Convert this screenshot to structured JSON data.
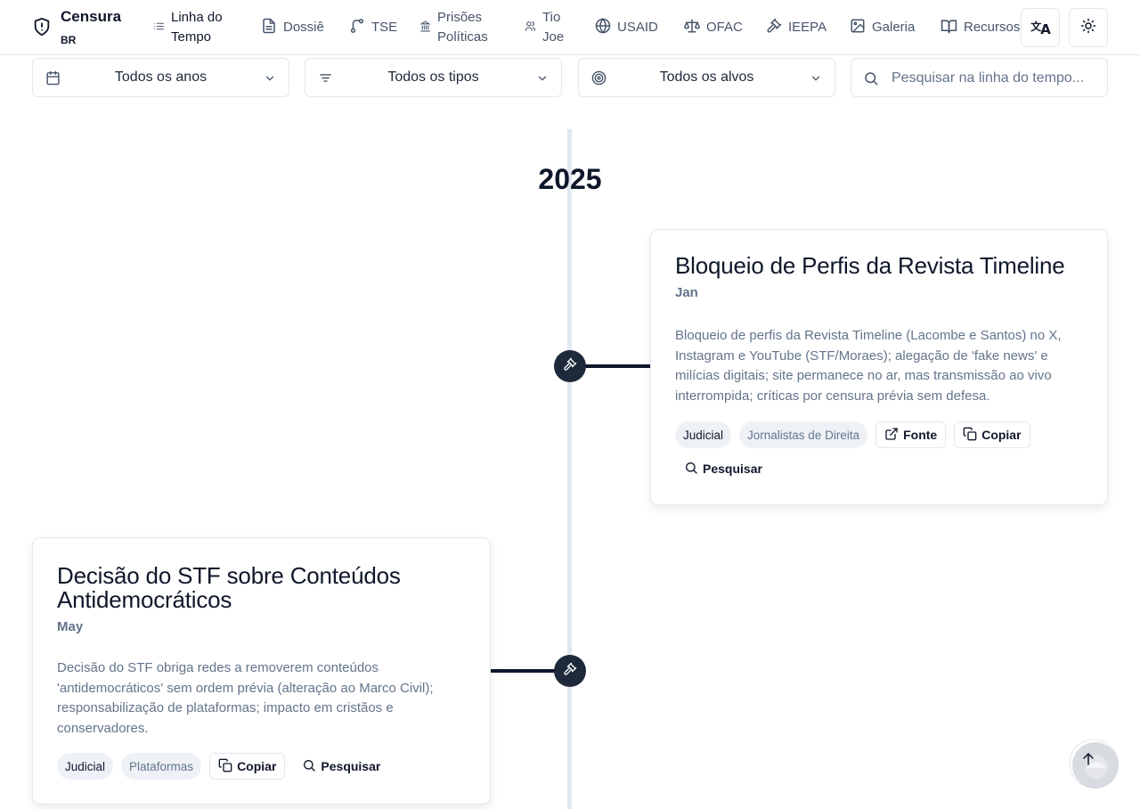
{
  "brand": {
    "title": "Censura",
    "subtitle": "BR"
  },
  "nav": {
    "timeline": "Linha do Tempo",
    "dossie": "Dossiê",
    "tse": "TSE",
    "prisoes": "Prisões Políticas",
    "tio_joe": "Tio Joe",
    "usaid": "USAID",
    "ofac": "OFAC",
    "ieepa": "IEEPA",
    "galeria": "Galeria",
    "recursos": "Recursos"
  },
  "filters": {
    "year": "Todos os anos",
    "type": "Todos os tipos",
    "target": "Todos os alvos",
    "search_placeholder": "Pesquisar na linha do tempo..."
  },
  "timeline": {
    "year": "2025",
    "events": [
      {
        "title": "Bloqueio de Perfis da Revista Timeline",
        "date": "Jan",
        "description": "Bloqueio de perfis da Revista Timeline (Lacombe e Santos) no X, Instagram e YouTube (STF/Moraes); alegação de 'fake news' e milícias digitais; site permanece no ar, mas transmissão ao vivo interrompida; críticas por censura prévia sem defesa.",
        "tag_type": "Judicial",
        "tag_target": "Jornalistas de Direita",
        "source_label": "Fonte",
        "copy_label": "Copiar",
        "search_label": "Pesquisar"
      },
      {
        "title": "Decisão do STF sobre Conteúdos Antidemocráticos",
        "date": "May",
        "description": "Decisão do STF obriga redes a removerem conteúdos 'antidemocráticos' sem ordem prévia (alteração ao Marco Civil); responsabilização de plataformas; impacto em cristãos e conservadores.",
        "tag_type": "Judicial",
        "tag_target": "Plataformas",
        "copy_label": "Copiar",
        "search_label": "Pesquisar"
      }
    ]
  },
  "colors": {
    "ink": "#0f172a",
    "muted": "#64748b",
    "line": "#e2e8f0",
    "node": "#1e293b"
  }
}
